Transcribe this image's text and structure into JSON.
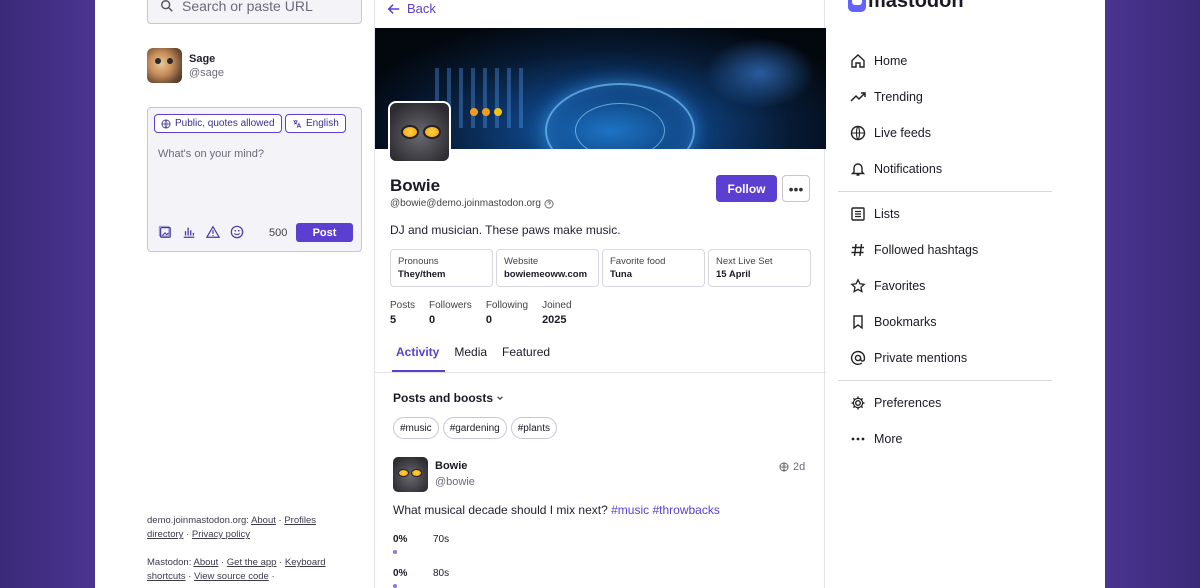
{
  "search": {
    "placeholder": "Search or paste URL"
  },
  "me": {
    "name": "Sage",
    "handle": "@sage"
  },
  "composer": {
    "visibility": "Public, quotes allowed",
    "language": "English",
    "placeholder": "What's on your mind?",
    "char_count": "500",
    "post_label": "Post"
  },
  "footer": {
    "server": "demo.joinmastodon.org",
    "about": "About",
    "profiles": "Profiles",
    "directory": "directory",
    "privacy": "Privacy policy",
    "mastodon": "Mastodon",
    "m_about": "About",
    "get_app": "Get the app",
    "keyboard": "Keyboard",
    "shortcuts": "shortcuts",
    "source": "View source code"
  },
  "profile": {
    "back": "Back",
    "display_name": "Bowie",
    "acct": "@bowie@demo.joinmastodon.org",
    "follow": "Follow",
    "bio": "DJ and musician. These paws make music.",
    "fields": [
      {
        "k": "Pronouns",
        "v": "They/them"
      },
      {
        "k": "Website",
        "v": "bowiemeoww.com"
      },
      {
        "k": "Favorite food",
        "v": "Tuna"
      },
      {
        "k": "Next Live Set",
        "v": "15 April"
      }
    ],
    "stats": [
      {
        "k": "Posts",
        "v": "5"
      },
      {
        "k": "Followers",
        "v": "0"
      },
      {
        "k": "Following",
        "v": "0"
      },
      {
        "k": "Joined",
        "v": "2025"
      }
    ],
    "tabs": [
      "Activity",
      "Media",
      "Featured"
    ],
    "filter": "Posts and boosts",
    "tags": [
      "#music",
      "#gardening",
      "#plants"
    ]
  },
  "post": {
    "name": "Bowie",
    "handle": "@bowie",
    "time": "2d",
    "text": "What musical decade should I mix next? ",
    "hashtags": [
      "#music",
      "#throwbacks"
    ],
    "poll": [
      {
        "pct": "0%",
        "label": "70s",
        "fraction": 0
      },
      {
        "pct": "0%",
        "label": "80s",
        "fraction": 0
      }
    ]
  },
  "nav": {
    "logo": "mastodon",
    "items": [
      {
        "label": "Home",
        "icon": "home-icon"
      },
      {
        "label": "Trending",
        "icon": "trending-icon"
      },
      {
        "label": "Live feeds",
        "icon": "globe-icon"
      },
      {
        "label": "Notifications",
        "icon": "bell-icon"
      },
      {
        "label": "Lists",
        "icon": "list-icon"
      },
      {
        "label": "Followed hashtags",
        "icon": "hashtag-icon"
      },
      {
        "label": "Favorites",
        "icon": "star-icon"
      },
      {
        "label": "Bookmarks",
        "icon": "bookmark-icon"
      },
      {
        "label": "Private mentions",
        "icon": "at-icon"
      },
      {
        "label": "Preferences",
        "icon": "gear-icon"
      },
      {
        "label": "More",
        "icon": "more-icon"
      }
    ]
  },
  "colors": {
    "accent": "#5b3fd1",
    "background": "#4a3490"
  }
}
